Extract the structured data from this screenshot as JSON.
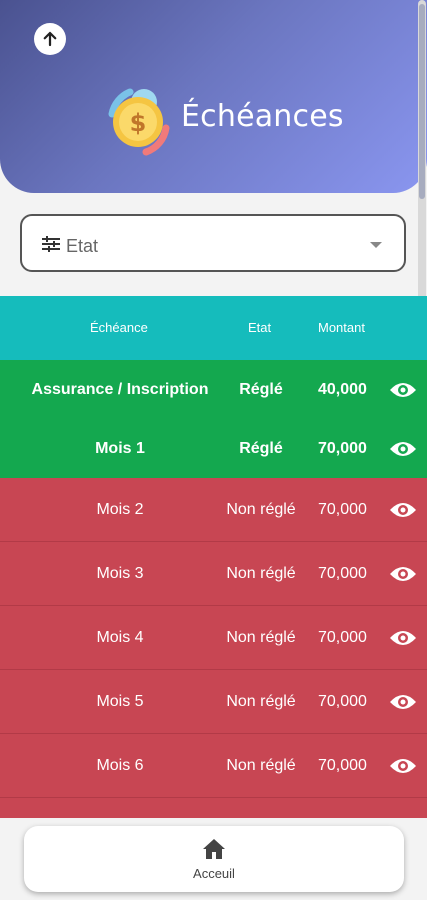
{
  "header": {
    "title": "Échéances"
  },
  "filter": {
    "label": "Etat"
  },
  "table": {
    "columns": [
      "Échéance",
      "Etat",
      "Montant"
    ],
    "rows": [
      {
        "name": "Assurance / Inscription",
        "status": "Réglé",
        "amount": "40,000"
      },
      {
        "name": "Mois 1",
        "status": "Réglé",
        "amount": "70,000"
      },
      {
        "name": "Mois 2",
        "status": "Non réglé",
        "amount": "70,000"
      },
      {
        "name": "Mois 3",
        "status": "Non réglé",
        "amount": "70,000"
      },
      {
        "name": "Mois 4",
        "status": "Non réglé",
        "amount": "70,000"
      },
      {
        "name": "Mois 5",
        "status": "Non réglé",
        "amount": "70,000"
      },
      {
        "name": "Mois 6",
        "status": "Non réglé",
        "amount": "70,000"
      }
    ]
  },
  "nav": {
    "home_label": "Acceuil"
  },
  "colors": {
    "header": "#5b64a8",
    "teal": "#15bcbc",
    "paid": "#14a84f",
    "unpaid": "#c84653"
  },
  "icons": {
    "back": "arrow-up-icon",
    "logo": "money-cycle-icon",
    "filter": "sliders-icon",
    "view": "eye-icon",
    "home": "home-icon"
  }
}
